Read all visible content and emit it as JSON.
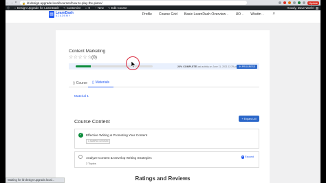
{
  "browser": {
    "url": "ld-design-upgrade.local/courses/how-to-play-the-piano/",
    "lock_icon": "lock-icon",
    "update_label": "Update",
    "status_text": "Waiting for ld-design-upgrade.local..."
  },
  "adminbar": {
    "site_name": "Design Upgrade for LearnDash",
    "customize": "Customize",
    "comments_count": "0",
    "new_label": "New",
    "edit_label": "Edit Course",
    "greeting": "Howdy, Dave Warfel"
  },
  "site": {
    "logo_name": "LearnDash",
    "logo_sub": "ACADEMY",
    "nav": [
      "Profile",
      "Course Grid",
      "Basic LearnDash Overview",
      "UO",
      "Wisdm"
    ],
    "accent": "#235af3"
  },
  "course": {
    "title": "Content Marketing",
    "stars": "☆☆☆☆☆",
    "rating_count": "(0)",
    "progress": {
      "percent": 20,
      "label": "20% COMPLETE",
      "activity": "Last activity on June 11, 2021 12:29 pm",
      "status": "IN PROGRESS"
    },
    "tabs": [
      {
        "label": "Course",
        "icon": "course-icon"
      },
      {
        "label": "Materials",
        "icon": "materials-icon"
      }
    ],
    "material_text": "Material 1",
    "content_title": "Course Content",
    "expand_all": "Expand All",
    "lessons": [
      {
        "title": "Effective Writing & Promoting Your Content",
        "chip": "1 SAMPLE LESSON",
        "complete": true
      },
      {
        "title": "Analyze Content & Develop Writing Strategies",
        "meta": "2 Topics",
        "expand": "Expand",
        "complete": false
      }
    ],
    "ratings_title": "Ratings and Reviews"
  }
}
